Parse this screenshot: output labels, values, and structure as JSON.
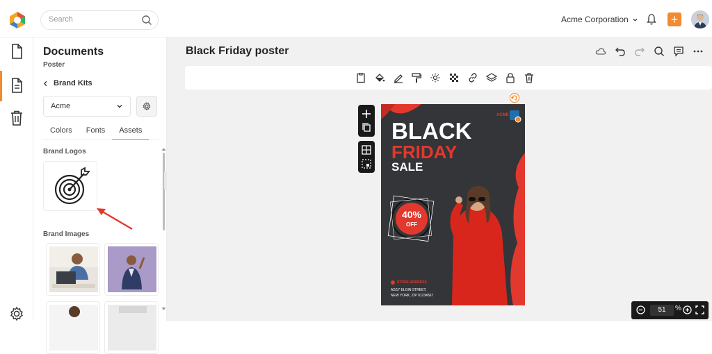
{
  "header": {
    "search_placeholder": "Search",
    "org_name": "Acme Corporation",
    "plus_label": "+"
  },
  "panel": {
    "title": "Documents",
    "subtitle": "Poster",
    "back_label": "Brand Kits",
    "brand_select": "Acme",
    "tabs": [
      "Colors",
      "Fonts",
      "Assets"
    ],
    "active_tab": "Assets",
    "brand_logos_title": "Brand Logos",
    "brand_images_title": "Brand Images",
    "collapse_glyph": "‹"
  },
  "editor": {
    "doc_title": "Black Friday poster",
    "zoom_value": "51",
    "zoom_unit": "%"
  },
  "poster": {
    "brand": "ACME",
    "line1": "BLACK",
    "line2": "FRIDAY",
    "line3": "SALE",
    "discount": "40%",
    "discount_sub": "OFF",
    "address_title": "STORE ADDRESS",
    "address_line1": "A2/17 ELGIN STREET,",
    "address_line2": "NEW YORK, ZIP 01234567"
  },
  "colors": {
    "accent": "#f28a30",
    "poster_red": "#e3382e",
    "poster_dark": "#333538"
  },
  "icons": {
    "rail": [
      "document-icon",
      "notes-icon",
      "trash-icon",
      "settings-icon"
    ],
    "toolbar": [
      "clipboard-icon",
      "fill-icon",
      "pen-icon",
      "paint-roller-icon",
      "brightness-icon",
      "transparency-icon",
      "link-icon",
      "layers-icon",
      "lock-icon",
      "delete-icon"
    ],
    "top_actions": [
      "cloud-icon",
      "undo-icon",
      "redo-icon",
      "search-icon",
      "comment-icon",
      "more-icon"
    ]
  }
}
